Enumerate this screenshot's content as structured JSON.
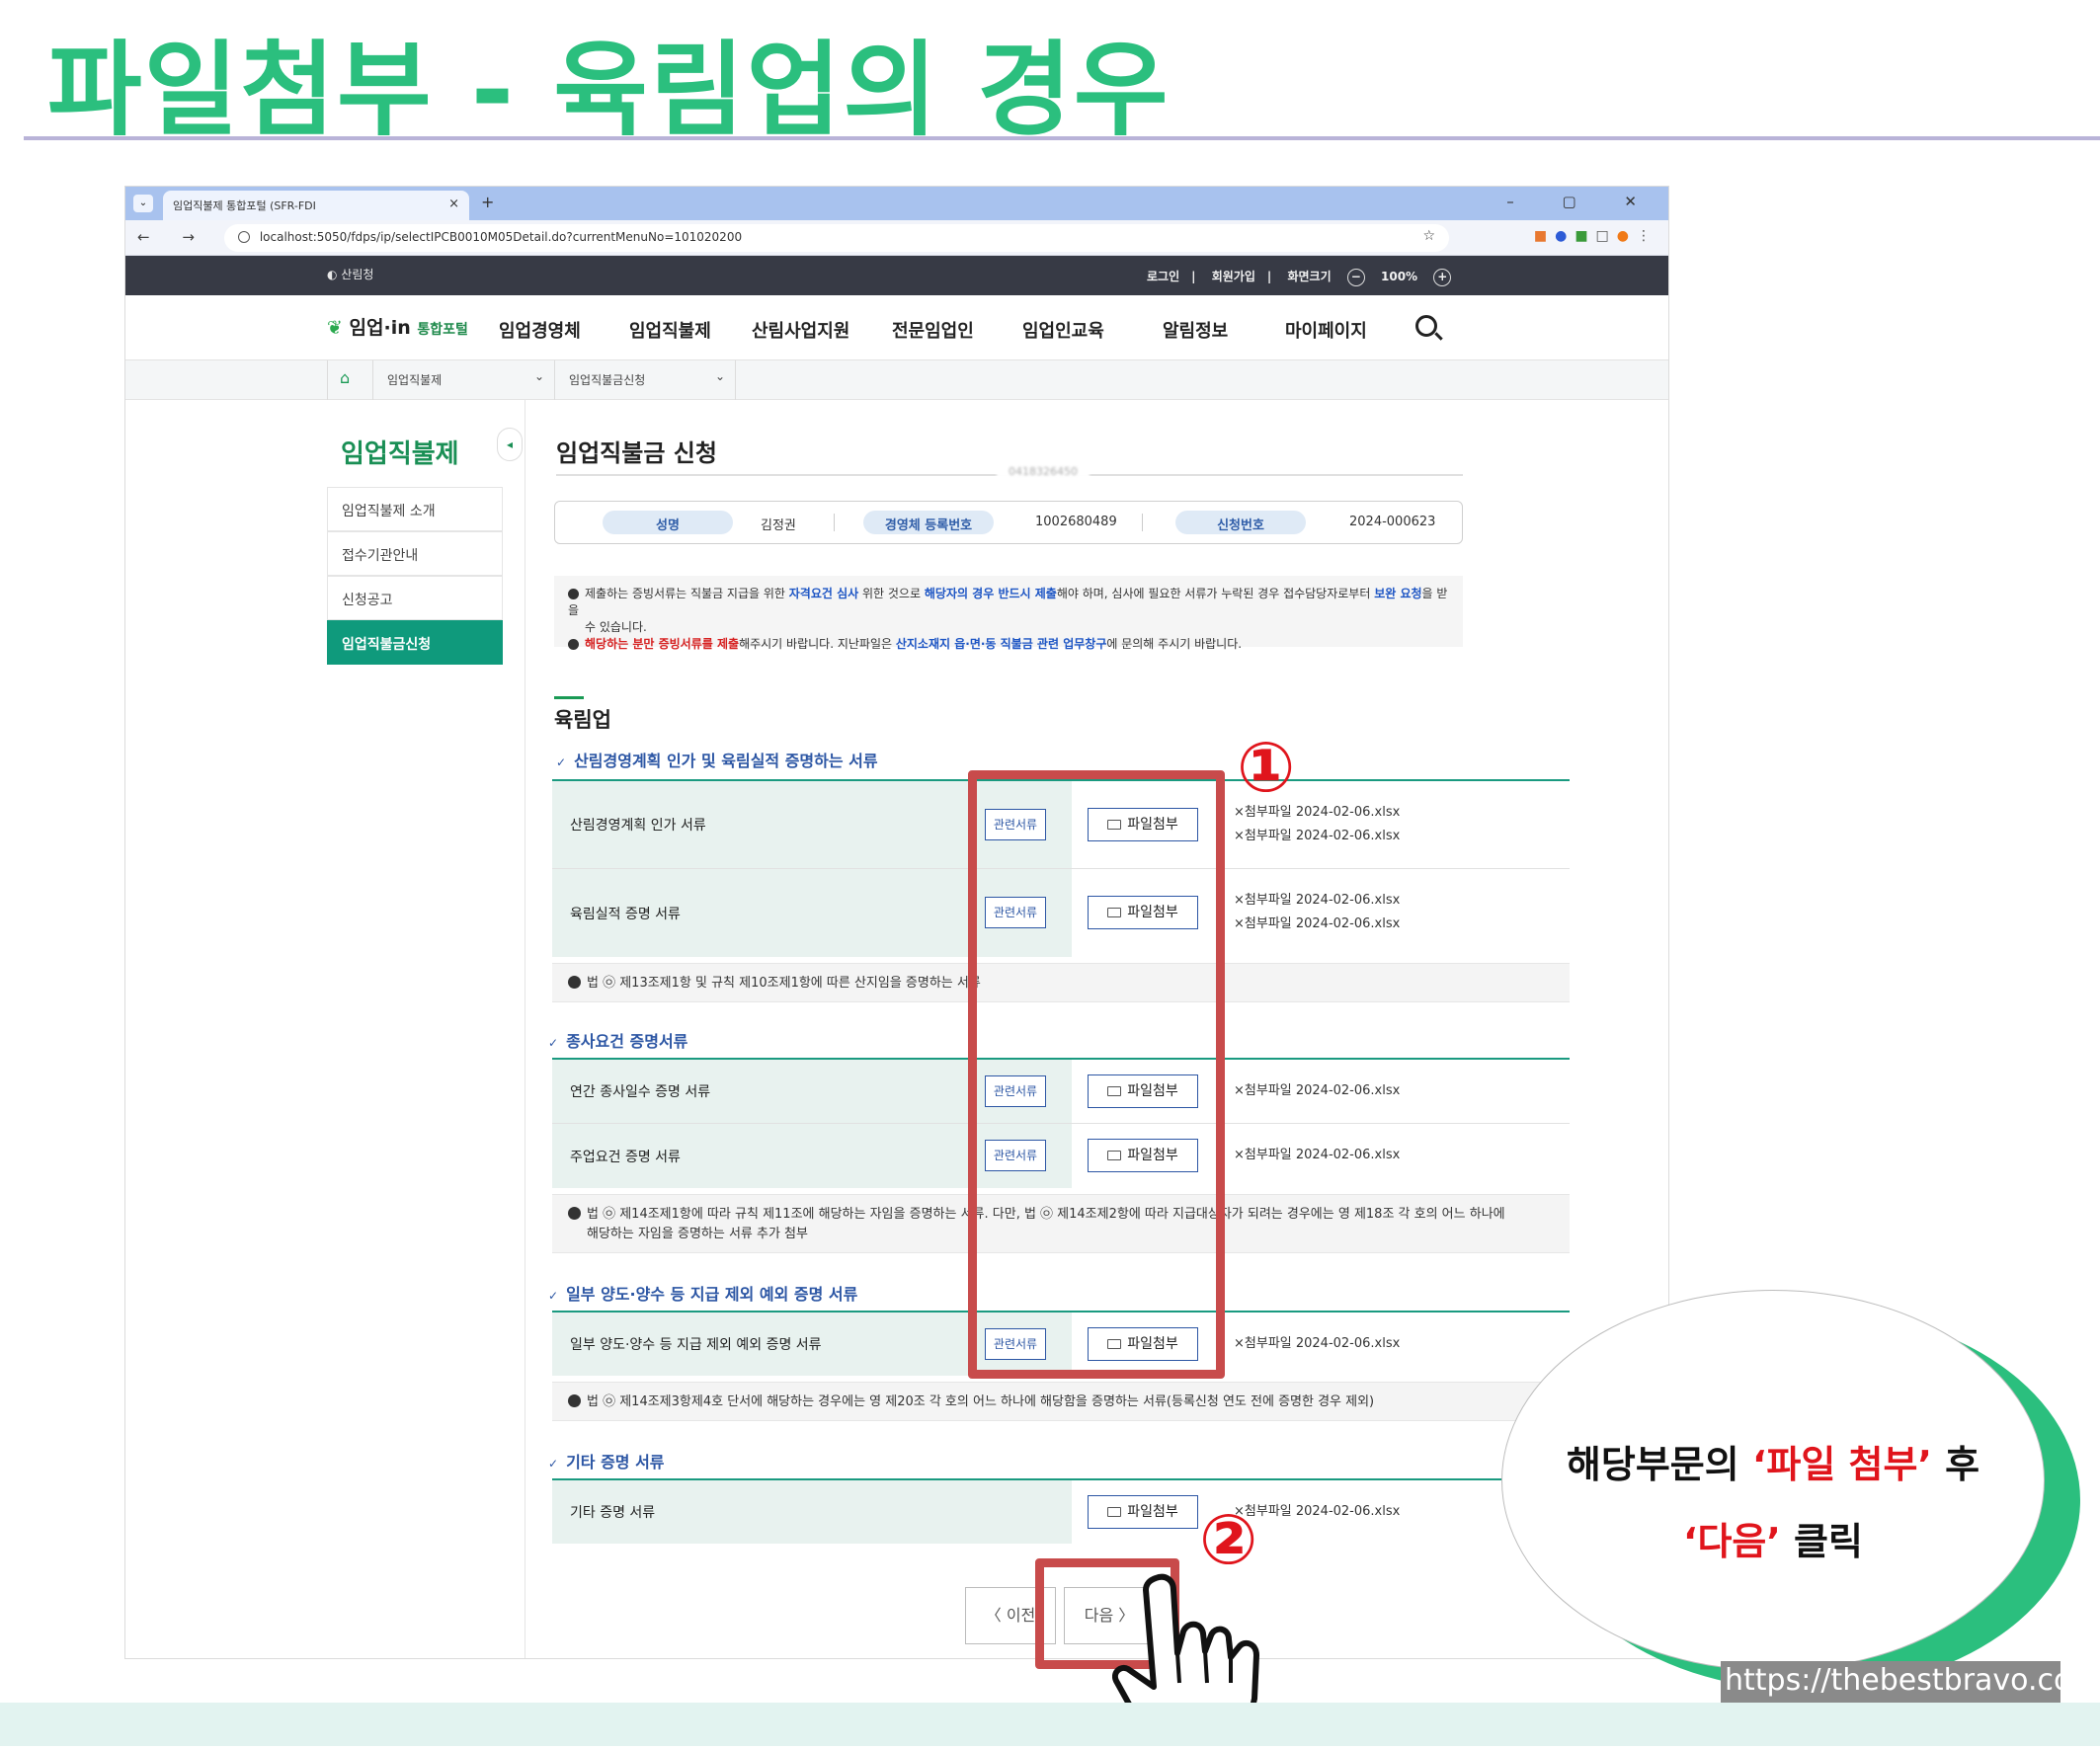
{
  "slide": {
    "title": "파일첨부 - 육림업의 경우",
    "bubble_prefix": "해당부문의 ",
    "bubble_hl1": "‘파일 첨부’",
    "bubble_mid": " 후",
    "bubble_hl2": "‘다음’",
    "bubble_suffix": " 클릭",
    "callout_1": "①",
    "callout_2": "②",
    "watermark": "https://thebestbravo.com"
  },
  "browser": {
    "tab_title": "임업직불제 통합포털 (SFR-FDI",
    "tab_close": "×",
    "new_tab": "+",
    "url": "localhost:5050/fdps/ip/selectIPCB0010M05Detail.do?currentMenuNo=101020200",
    "window_controls": "– ▢ ✕",
    "nav_buttons": "← → C"
  },
  "site": {
    "gov_logo": "산림청",
    "util": [
      "로그인",
      "회원가입",
      "화면크기",
      "100%"
    ],
    "brand": "임업·in",
    "brand_sub": "통합포털",
    "menu": [
      "임업경영체",
      "임업직불제",
      "산림사업지원",
      "전문임업인",
      "임업인교육",
      "알림정보",
      "마이페이지"
    ],
    "breadcrumb": [
      "임업직불제",
      "임업직불금신청"
    ],
    "lnb_title": "임업직불제",
    "lnb_items": [
      "임업직불제 소개",
      "접수기관안내",
      "신청공고",
      "임업직불금신청"
    ],
    "page_title": "임업직불금 신청",
    "masked_id": "0418326450",
    "info": {
      "name_label": "성명",
      "name_value": "김정권",
      "reg_label": "경영체 등록번호",
      "reg_value": "1002680489",
      "app_label": "신청번호",
      "app_value": "2024-000623"
    },
    "notice": {
      "line1_a": "제출하는 증빙서류는 직불금 지급을 위한 ",
      "line1_b": "자격요건 심사",
      "line1_c": " 위한 것으로 ",
      "line1_d": "해당자의 경우 반드시 제출",
      "line1_e": "해야 하며, 심사에 필요한 서류가 누락된 경우 접수담당자로부터 ",
      "line1_f": "보완 요청",
      "line1_g": "을 받을",
      "line2": "수 있습니다.",
      "line3_a": "해당하는 분만 증빙서류를 제출",
      "line3_b": "해주시기 바랍니다. 지난파일은 ",
      "line3_c": "산지소재지 읍·면·동 직불금 관련 업무창구",
      "line3_d": "에 문의해 주시기 바랍니다."
    },
    "section_title": "육림업",
    "groups": [
      {
        "title": "산림경영계획 인가 및 육림실적 증명하는 서류",
        "rows": [
          {
            "label": "산림경영계획 인가 서류",
            "rel": "관련서류",
            "file_btn": "파일첨부",
            "files": [
              "×첨부파일 2024-02-06.xlsx",
              "×첨부파일 2024-02-06.xlsx"
            ]
          },
          {
            "label": "육림실적 증명 서류",
            "rel": "관련서류",
            "file_btn": "파일첨부",
            "files": [
              "×첨부파일 2024-02-06.xlsx",
              "×첨부파일 2024-02-06.xlsx"
            ]
          }
        ],
        "note": "법 ㉧ 제13조제1항 및 규칙 제10조제1항에 따른 산지임을 증명하는 서류"
      },
      {
        "title": "종사요건 증명서류",
        "rows": [
          {
            "label": "연간 종사일수 증명 서류",
            "rel": "관련서류",
            "file_btn": "파일첨부",
            "files": [
              "×첨부파일 2024-02-06.xlsx"
            ]
          },
          {
            "label": "주업요건 증명 서류",
            "rel": "관련서류",
            "file_btn": "파일첨부",
            "files": [
              "×첨부파일 2024-02-06.xlsx"
            ]
          }
        ],
        "note_line1": "법 ㉧ 제14조제1항에 따라 규칙 제11조에 해당하는 자임을 증명하는 서류. 다만, 법 ㉧ 제14조제2항에 따라 지급대상자가 되려는 경우에는 영 제18조 각 호의 어느 하나에",
        "note_line2": "해당하는 자임을 증명하는 서류 추가 첨부"
      },
      {
        "title": "일부 양도·양수 등 지급 제외 예외 증명 서류",
        "rows": [
          {
            "label": "일부 양도·양수 등 지급 제외 예외 증명 서류",
            "rel": "관련서류",
            "file_btn": "파일첨부",
            "files": [
              "×첨부파일 2024-02-06.xlsx"
            ]
          }
        ],
        "note": "법 ㉧ 제14조제3항제4호 단서에 해당하는 경우에는 영 제20조 각 호의 어느 하나에 해당함을 증명하는 서류(등록신청 연도 전에 증명한 경우 제외)"
      },
      {
        "title": "기타 증명 서류",
        "rows": [
          {
            "label": "기타 증명 서류",
            "file_btn": "파일첨부",
            "files": [
              "×첨부파일 2024-02-06.xlsx"
            ]
          }
        ]
      }
    ],
    "pager": {
      "prev": "〈  이전",
      "next": "다음  〉"
    }
  }
}
